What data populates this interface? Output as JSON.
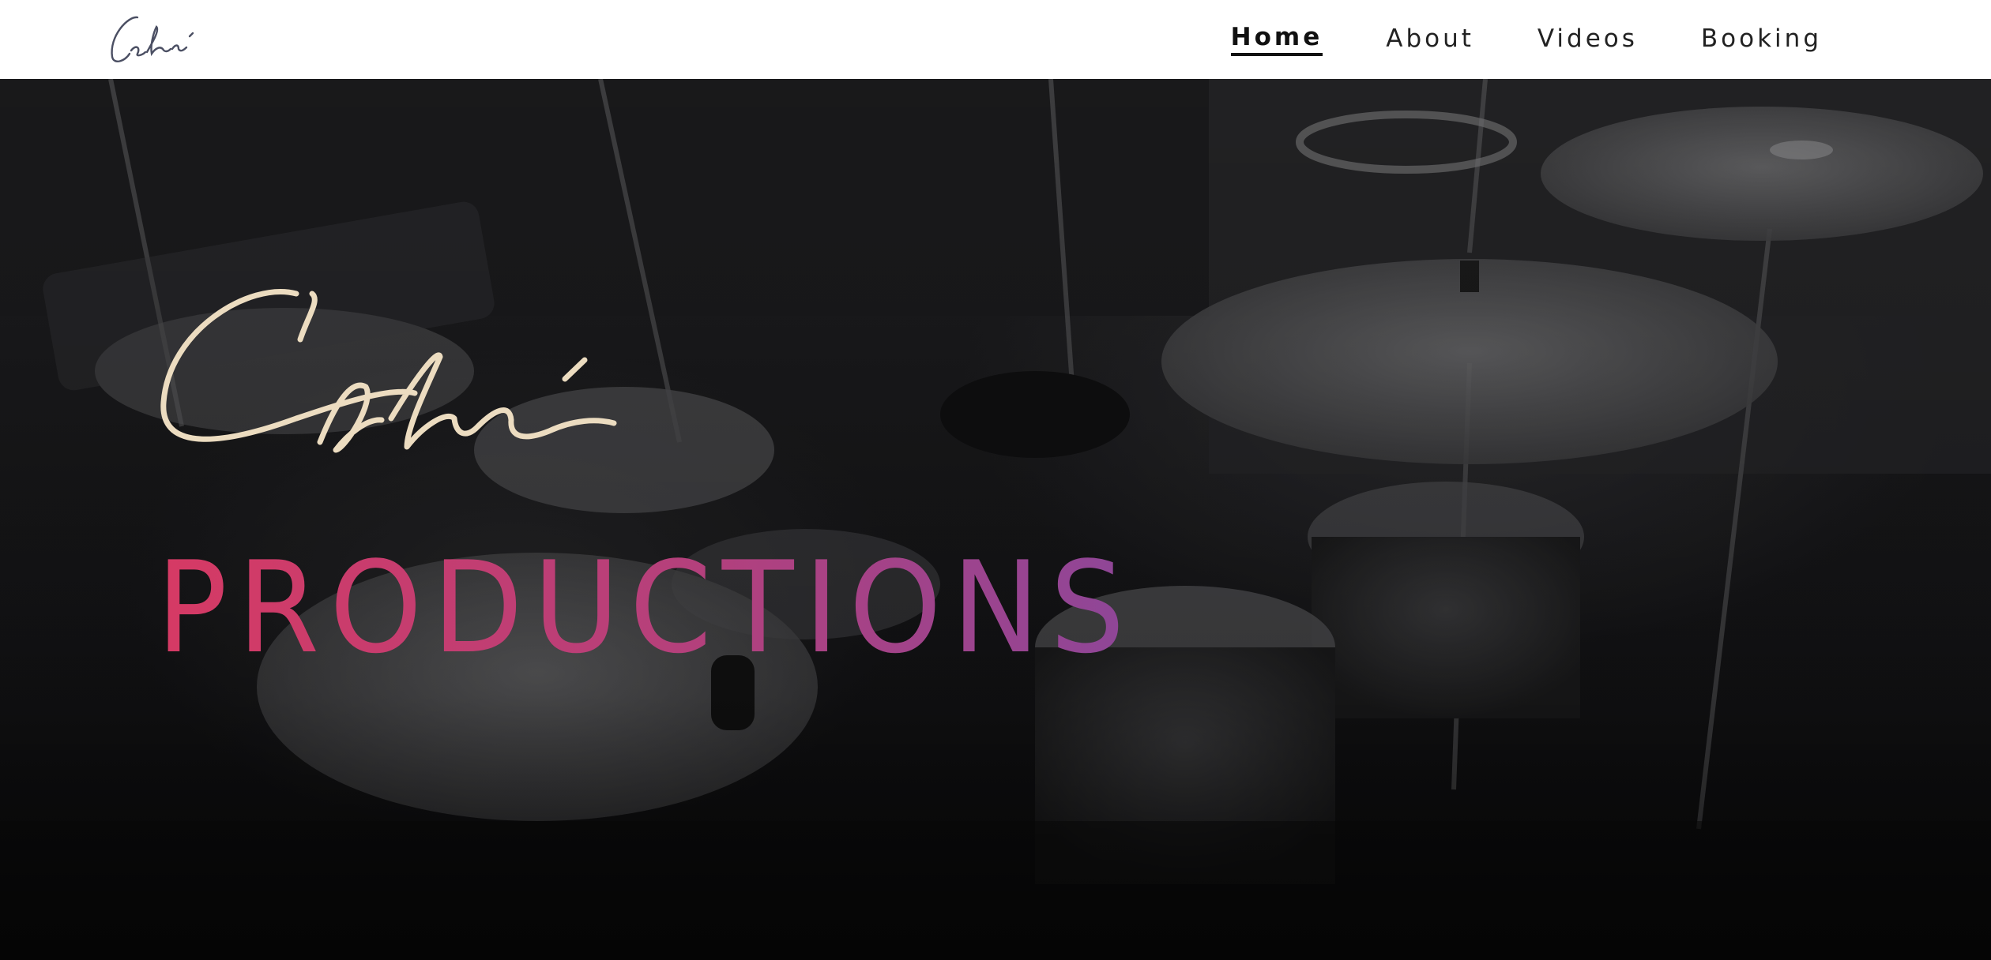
{
  "header": {
    "logo_icon": "calvi-signature-logo",
    "nav": [
      {
        "label": "Home",
        "active": true
      },
      {
        "label": "About",
        "active": false
      },
      {
        "label": "Videos",
        "active": false
      },
      {
        "label": "Booking",
        "active": false
      }
    ]
  },
  "hero": {
    "background_image": "drum-kit-photo",
    "signature_icon": "calvi-signature",
    "title": "PRODUCTIONS"
  },
  "colors": {
    "title_gradient_start": "#d63a64",
    "title_gradient_end": "#8e4698",
    "signature": "#ecdcc0",
    "header_bg": "#ffffff"
  }
}
